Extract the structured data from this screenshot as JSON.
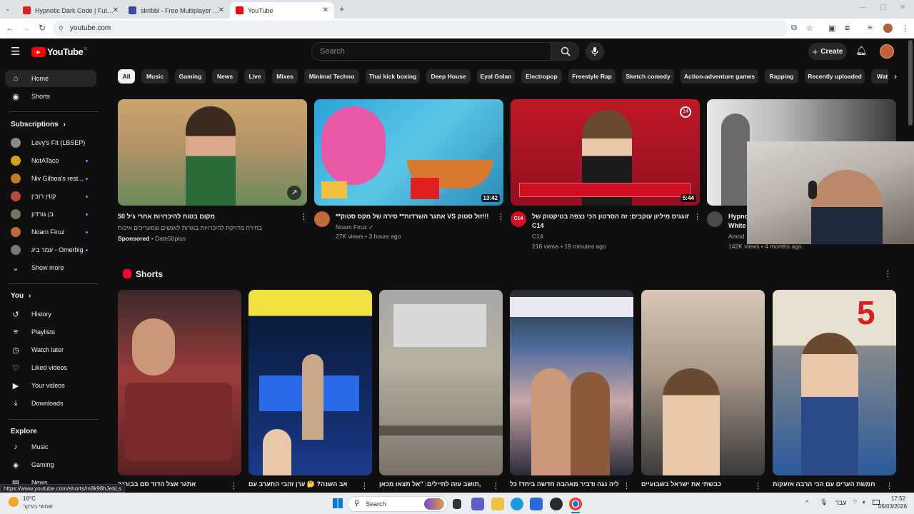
{
  "browser": {
    "tabs": [
      {
        "title": "Hypnotic Dark Code | Futuristic",
        "fav_color": "#e02020"
      },
      {
        "title": "skribbl - Free Multiplayer Draw",
        "fav_color": "#3b4a9a"
      },
      {
        "title": "YouTube",
        "fav_color": "#ff0000"
      }
    ],
    "new_tab": "+",
    "url": "youtube.com",
    "status_url": "https://www.youtube.com/shorts/m8k98hJebLs"
  },
  "header": {
    "logo_text": "YouTube",
    "region": "IL",
    "search_placeholder": "Search",
    "create_label": "Create"
  },
  "sidebar": {
    "main": [
      {
        "label": "Home",
        "icon": "home-icon",
        "glyph": "⌂"
      },
      {
        "label": "Shorts",
        "icon": "shorts-icon",
        "glyph": "◉"
      }
    ],
    "subscriptions_title": "Subscriptions",
    "subscriptions": [
      {
        "label": "Levy's Fit (LBSEP)",
        "color": "#8a8a8a",
        "dot": false
      },
      {
        "label": "NotATaco",
        "color": "#d4a017",
        "dot": true
      },
      {
        "label": "Niv Gilboa's rest...",
        "color": "#c47a2c",
        "dot": true
      },
      {
        "label": "קווין רובין",
        "color": "#b84a3a",
        "dot": true
      },
      {
        "label": "בן גורדון",
        "color": "#6b7a5c",
        "dot": true
      },
      {
        "label": "Noam Firuz",
        "color": "#c06a3a",
        "dot": true
      },
      {
        "label": "עמר ביג - Omerbig",
        "color": "#777777",
        "dot": true
      }
    ],
    "show_more": "Show more",
    "you_title": "You",
    "you_items": [
      {
        "label": "History",
        "glyph": "↺",
        "icon": "history-icon"
      },
      {
        "label": "Playlists",
        "glyph": "≡",
        "icon": "playlists-icon"
      },
      {
        "label": "Watch later",
        "glyph": "◷",
        "icon": "watch-later-icon"
      },
      {
        "label": "Liked videos",
        "glyph": "👍",
        "icon": "like-icon"
      },
      {
        "label": "Your videos",
        "glyph": "▶",
        "icon": "your-videos-icon"
      },
      {
        "label": "Downloads",
        "glyph": "⤓",
        "icon": "download-icon"
      }
    ],
    "explore_title": "Explore",
    "explore_items": [
      {
        "label": "Music",
        "glyph": "♪",
        "icon": "music-icon"
      },
      {
        "label": "Gaming",
        "glyph": "🎮",
        "icon": "gaming-icon"
      },
      {
        "label": "News",
        "glyph": "▤",
        "icon": "news-icon"
      }
    ]
  },
  "chips": [
    "All",
    "Music",
    "Gaming",
    "News",
    "Live",
    "Mixes",
    "Minimal Techno",
    "Thai kick boxing",
    "Deep House",
    "Eyal Golan",
    "Electropop",
    "Freestyle Rap",
    "Sketch comedy",
    "Action-adventure games",
    "Rapping",
    "Recently uploaded",
    "Wat"
  ],
  "videos": [
    {
      "title": "מקום בטוח להיכרויות אחרי גיל 50",
      "line2": "בחירה מדויקת להיכרויות בוגרות לאנשים שמעריכים איכות",
      "meta": "Sponsored",
      "channel": "Date50plus",
      "duration": "",
      "colors": [
        "#c9a56b",
        "#6b8a5a",
        "#3b5b3a"
      ]
    },
    {
      "title": "**אתגר השרדות** סירה של מקס סטוק VS זול סטוק!!!",
      "line2": "",
      "meta": "Noam Firuz ✓",
      "channel": "27K views • 3 hours ago",
      "duration": "13:42",
      "colors": [
        "#2aa3d8",
        "#e85aa8",
        "#f0c040"
      ]
    },
    {
      "title": "חוגגים מיליון עוקבים: זה הסרטון הכי נצפה בטיקטוק של",
      "line2": "C14",
      "meta": "C14",
      "channel": "216 views • 19 minutes ago",
      "duration": "5:44",
      "colors": [
        "#b01020",
        "#1a1a1a",
        "#e8d8c8"
      ]
    },
    {
      "title": "Hypno",
      "line2": "White",
      "meta": "Amod",
      "channel": "142K views • 4 months ago",
      "duration": "",
      "colors": [
        "#d8d8d8",
        "#2a2a2a",
        "#888888"
      ]
    }
  ],
  "shorts_title": "Shorts",
  "shorts": [
    {
      "title": "אתגר אצל הדוד סם בבורגר",
      "colors": [
        "#5a2a2a",
        "#9b3b3b",
        "#2a1a1a"
      ]
    },
    {
      "title": "אב השנה? 🤔 ערן זהבי התערב עם",
      "colors": [
        "#1a3a8a",
        "#f0e040",
        "#0a1a3a"
      ]
    },
    {
      "title": "תושב עזה לחיילים: \"אל תצאו מכאן,",
      "colors": [
        "#9a9a9a",
        "#b8b0a0",
        "#6a6258"
      ]
    },
    {
      "title": "ליה נגה ודביר מאהבה חדשה ביחד! כל",
      "colors": [
        "#c04060",
        "#4a6a9a",
        "#2a2a3a"
      ]
    },
    {
      "title": "כבשתי את ישראל בשבועיים",
      "colors": [
        "#8a7a68",
        "#3a3a3a",
        "#c8b8a8"
      ]
    },
    {
      "title": "חמשת הערים עם הכי הרבה אזעקות",
      "colors": [
        "#d82020",
        "#2a5a9a",
        "#e8e0d0"
      ]
    }
  ],
  "taskbar": {
    "weather_temp": "16°C",
    "weather_desc": "שמשי בעיקר",
    "search_label": "Search",
    "lang": "עבר",
    "time": "17:52",
    "date": "05/03/2026"
  }
}
